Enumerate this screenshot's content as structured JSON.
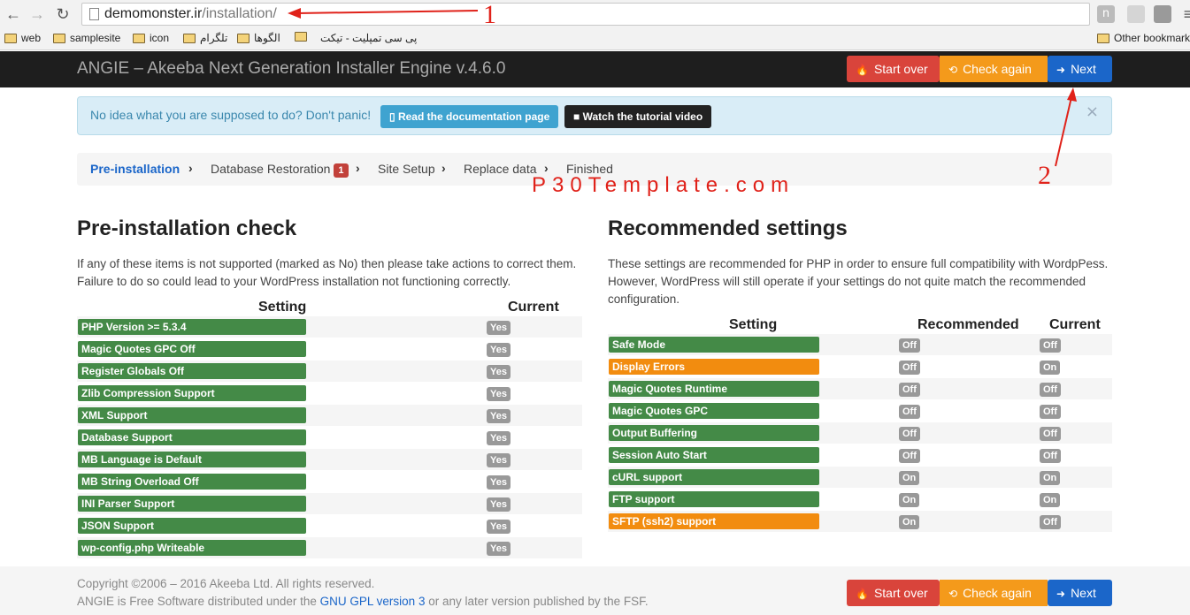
{
  "browser": {
    "url_host": "demomonster.ir",
    "url_path": "/installation/",
    "extension_letter": "n",
    "bookmarks": [
      "web",
      "samplesite",
      "icon",
      "تلگرام",
      "الگوها",
      "",
      "پی سی تمپلیت - تیکت"
    ],
    "other_bookmarks": "Other bookmarks"
  },
  "annotations": {
    "one": "1",
    "two": "2",
    "watermark": "P30Template.com"
  },
  "app": {
    "title": "ANGIE – Akeeba Next Generation Installer Engine v.4.6.0",
    "buttons": {
      "start_over": "Start over",
      "check_again": "Check again",
      "next": "Next"
    }
  },
  "alert": {
    "text": "No idea what you are supposed to do? Don't panic!",
    "docs": "Read the documentation page",
    "video": "Watch the tutorial video",
    "close": "×"
  },
  "breadcrumb": {
    "steps": [
      "Pre-installation",
      "Database Restoration",
      "Site Setup",
      "Replace data",
      "Finished"
    ],
    "badge": "1"
  },
  "precheck": {
    "title": "Pre-installation check",
    "intro": "If any of these items is not supported (marked as No) then please take actions to correct them. Failure to do so could lead to your WordPress installation not functioning correctly.",
    "col_setting": "Setting",
    "col_current": "Current",
    "rows": [
      {
        "label": "PHP Version >= 5.3.4",
        "current": "Yes"
      },
      {
        "label": "Magic Quotes GPC Off",
        "current": "Yes"
      },
      {
        "label": "Register Globals Off",
        "current": "Yes"
      },
      {
        "label": "Zlib Compression Support",
        "current": "Yes"
      },
      {
        "label": "XML Support",
        "current": "Yes"
      },
      {
        "label": "Database Support",
        "current": "Yes"
      },
      {
        "label": "MB Language is Default",
        "current": "Yes"
      },
      {
        "label": "MB String Overload Off",
        "current": "Yes"
      },
      {
        "label": "INI Parser Support",
        "current": "Yes"
      },
      {
        "label": "JSON Support",
        "current": "Yes"
      },
      {
        "label": "wp-config.php Writeable",
        "current": "Yes"
      }
    ]
  },
  "recommended": {
    "title": "Recommended settings",
    "intro": "These settings are recommended for PHP in order to ensure full compatibility with WordpPess. However, WordPress will still operate if your settings do not quite match the recommended configuration.",
    "col_setting": "Setting",
    "col_recommended": "Recommended",
    "col_current": "Current",
    "rows": [
      {
        "label": "Safe Mode",
        "recommended": "Off",
        "current": "Off",
        "status": "ok"
      },
      {
        "label": "Display Errors",
        "recommended": "Off",
        "current": "On",
        "status": "warn"
      },
      {
        "label": "Magic Quotes Runtime",
        "recommended": "Off",
        "current": "Off",
        "status": "ok"
      },
      {
        "label": "Magic Quotes GPC",
        "recommended": "Off",
        "current": "Off",
        "status": "ok"
      },
      {
        "label": "Output Buffering",
        "recommended": "Off",
        "current": "Off",
        "status": "ok"
      },
      {
        "label": "Session Auto Start",
        "recommended": "Off",
        "current": "Off",
        "status": "ok"
      },
      {
        "label": "cURL support",
        "recommended": "On",
        "current": "On",
        "status": "ok"
      },
      {
        "label": "FTP support",
        "recommended": "On",
        "current": "On",
        "status": "ok"
      },
      {
        "label": "SFTP (ssh2) support",
        "recommended": "On",
        "current": "Off",
        "status": "warn"
      }
    ]
  },
  "footer": {
    "copyright": "Copyright ©2006 – 2016 Akeeba Ltd. All rights reserved.",
    "license_pre": "ANGIE is Free Software distributed under the",
    "license_link": "GNU GPL version 3",
    "license_post": "or any later version published by the FSF."
  }
}
